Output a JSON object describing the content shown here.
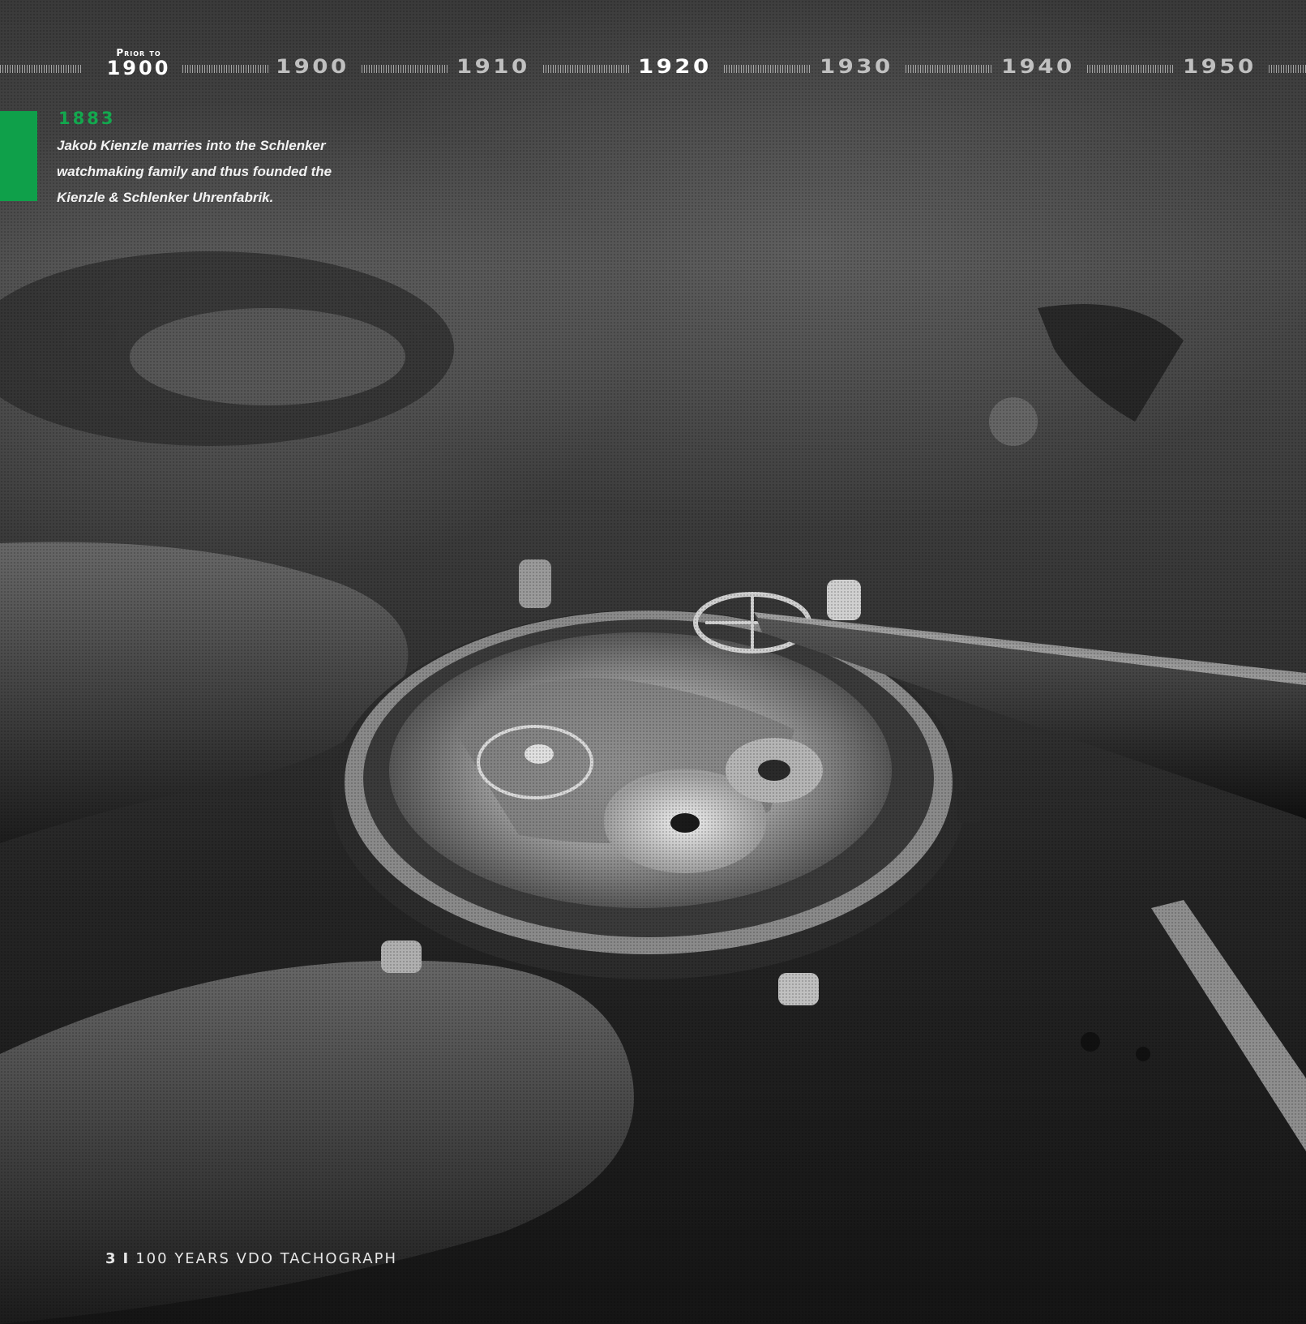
{
  "timeline": {
    "prior_small": "Prior to",
    "prior_year": "1900",
    "decades": [
      "1900",
      "1910",
      "1920",
      "1930",
      "1940",
      "1950"
    ],
    "active_decade": "1920"
  },
  "event": {
    "year": "1883",
    "text_lines": [
      "Jakob Kienzle marries into the Schlenker",
      "watchmaking family and thus founded the",
      "Kienzle & Schlenker Uhrenfabrik."
    ],
    "accent_color": "#0fa04a"
  },
  "footer": {
    "page_number": "3",
    "separator": "I",
    "title": "100 YEARS VDO TACHOGRAPH"
  },
  "image": {
    "subject": "watch-movement-photo"
  }
}
